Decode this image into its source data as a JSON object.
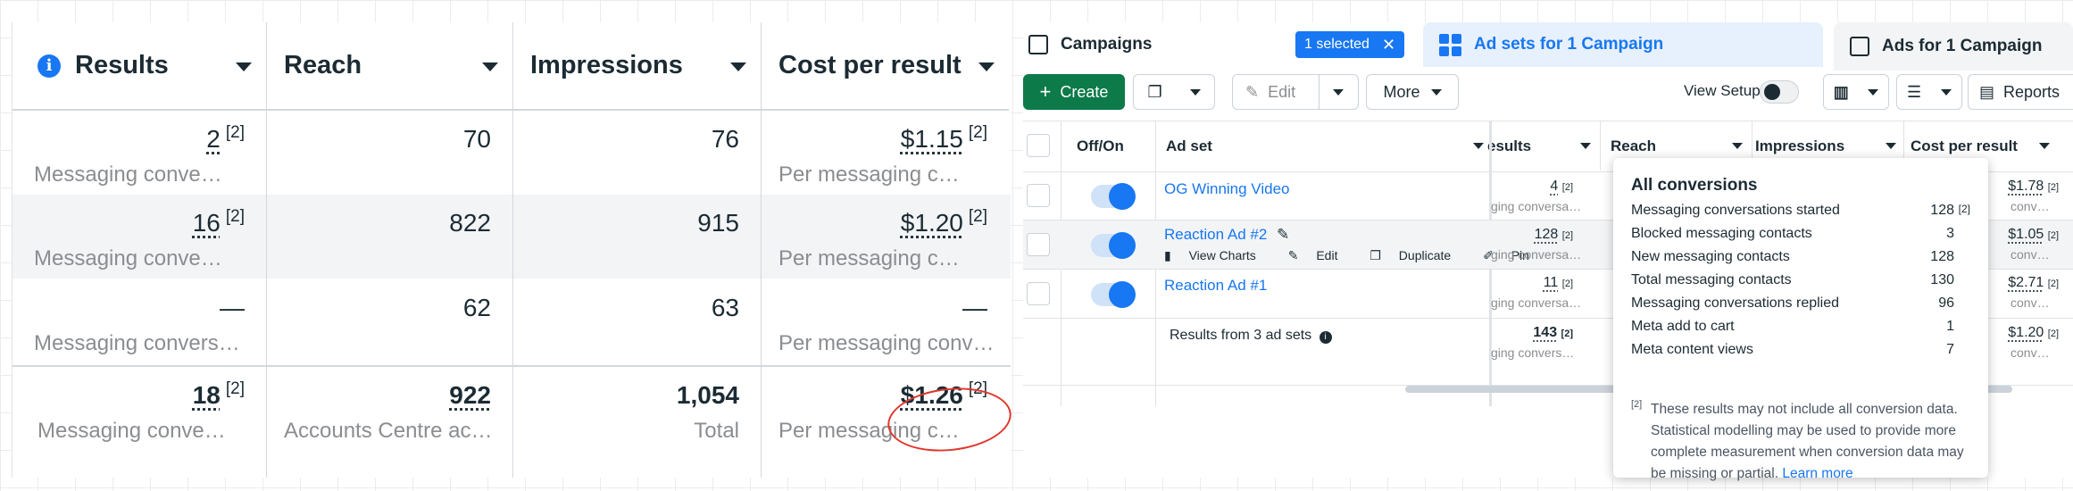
{
  "left": {
    "columns": [
      {
        "label": "Results",
        "info_icon": "info-icon"
      },
      {
        "label": "Reach"
      },
      {
        "label": "Impressions"
      },
      {
        "label": "Cost per result"
      }
    ],
    "rows": [
      {
        "results": "2",
        "results_sup": "[2]",
        "results_sub": "Messaging conve…",
        "reach": "70",
        "impressions": "76",
        "cost": "$1.15",
        "cost_sup": "[2]",
        "cost_sub": "Per messaging c…"
      },
      {
        "results": "16",
        "results_sup": "[2]",
        "results_sub": "Messaging conve…",
        "reach": "822",
        "impressions": "915",
        "cost": "$1.20",
        "cost_sup": "[2]",
        "cost_sub": "Per messaging c…"
      },
      {
        "results": "—",
        "results_sub": "Messaging convers…",
        "reach": "62",
        "impressions": "63",
        "cost": "—",
        "cost_sub": "Per messaging conv…"
      }
    ],
    "total": {
      "results": "18",
      "results_sup": "[2]",
      "results_sub": "Messaging conve…",
      "reach": "922",
      "reach_sub": "Accounts Centre ac…",
      "impressions": "1,054",
      "impressions_sub": "Total",
      "cost": "$1.26",
      "cost_sup": "[2]",
      "cost_sub": "Per messaging c…"
    },
    "annotation_color": "#e0362c"
  },
  "right": {
    "tabs": {
      "campaigns": "Campaigns",
      "selected_badge": "1 selected",
      "adsets": "Ad sets for 1 Campaign",
      "ads": "Ads for 1 Campaign"
    },
    "toolbar": {
      "create": "Create",
      "edit": "Edit",
      "more": "More",
      "view_setup": "View Setup",
      "reports": "Reports"
    },
    "headers": {
      "offon": "Off/On",
      "adset": "Ad set",
      "results": "esults",
      "reach": "Reach",
      "impressions": "Impressions",
      "cost": "Cost per result"
    },
    "rows": [
      {
        "name": "OG Winning Video",
        "results": "4",
        "results_sub": "ging conversa…",
        "cost": "$1.78",
        "cost_sub": "conv…"
      },
      {
        "name": "Reaction Ad #2",
        "results": "128",
        "results_sub": "ging conversa…",
        "cost": "$1.05",
        "cost_sub": "conv…"
      },
      {
        "name": "Reaction Ad #1",
        "results": "11",
        "results_sub": "ging conversa…",
        "cost": "$2.71",
        "cost_sub": "conv…"
      }
    ],
    "row_actions": [
      "View Charts",
      "Edit",
      "Duplicate",
      "Pin"
    ],
    "summary": {
      "label": "Results from 3 ad sets",
      "results": "143",
      "results_sub": "ging convers…",
      "cost": "$1.20",
      "cost_sub": "conv…"
    },
    "sup": "[2]",
    "popover": {
      "title": "All conversions",
      "items": [
        {
          "label": "Messaging conversations started",
          "value": "128",
          "sup": "[2]"
        },
        {
          "label": "Blocked messaging contacts",
          "value": "3"
        },
        {
          "label": "New messaging contacts",
          "value": "128"
        },
        {
          "label": "Total messaging contacts",
          "value": "130"
        },
        {
          "label": "Messaging conversations replied",
          "value": "96"
        },
        {
          "label": "Meta add to cart",
          "value": "1"
        },
        {
          "label": "Meta content views",
          "value": "7"
        }
      ],
      "note_sup": "[2]",
      "note": "These results may not include all conversion data. Statistical modelling may be used to provide more complete measurement when conversion data may be missing or partial.",
      "learn_more": "Learn more"
    },
    "accent": "#1877f2",
    "create_color": "#0d7a4a"
  }
}
